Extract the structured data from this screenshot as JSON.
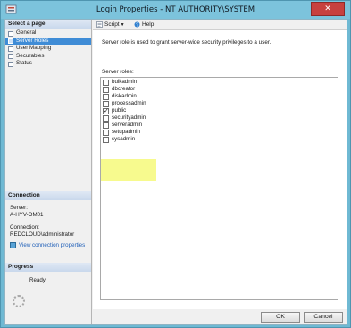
{
  "window": {
    "title": "Login Properties - NT AUTHORITY\\SYSTEM",
    "close_glyph": "✕"
  },
  "left_pane": {
    "select_page_header": "Select a page",
    "pages": [
      {
        "label": "General",
        "selected": false
      },
      {
        "label": "Server Roles",
        "selected": true
      },
      {
        "label": "User Mapping",
        "selected": false
      },
      {
        "label": "Securables",
        "selected": false
      },
      {
        "label": "Status",
        "selected": false
      }
    ],
    "connection_header": "Connection",
    "server_label": "Server:",
    "server_value": "A-HYV-OM01",
    "connection_label": "Connection:",
    "connection_value": "REDCLOUD\\administrator",
    "view_connection_link": "View connection properties",
    "progress_header": "Progress",
    "progress_status": "Ready"
  },
  "toolbar": {
    "script_label": "Script",
    "help_label": "Help"
  },
  "content": {
    "description": "Server role is used to grant server-wide security privileges to a user.",
    "roles_label": "Server roles:",
    "roles": [
      {
        "name": "bulkadmin",
        "checked": false
      },
      {
        "name": "dbcreator",
        "checked": false
      },
      {
        "name": "diskadmin",
        "checked": false
      },
      {
        "name": "processadmin",
        "checked": false
      },
      {
        "name": "public",
        "checked": true
      },
      {
        "name": "securityadmin",
        "checked": false
      },
      {
        "name": "serveradmin",
        "checked": false
      },
      {
        "name": "setupadmin",
        "checked": false
      },
      {
        "name": "sysadmin",
        "checked": false
      }
    ],
    "highlighted_role": "sysadmin",
    "highlight_color": "#f6f97a"
  },
  "footer": {
    "ok_label": "OK",
    "cancel_label": "Cancel"
  },
  "colors": {
    "title_bar": "#7cc3dc",
    "selection": "#3f8cd6",
    "link": "#1f5fb8",
    "close_button": "#c7413f"
  }
}
